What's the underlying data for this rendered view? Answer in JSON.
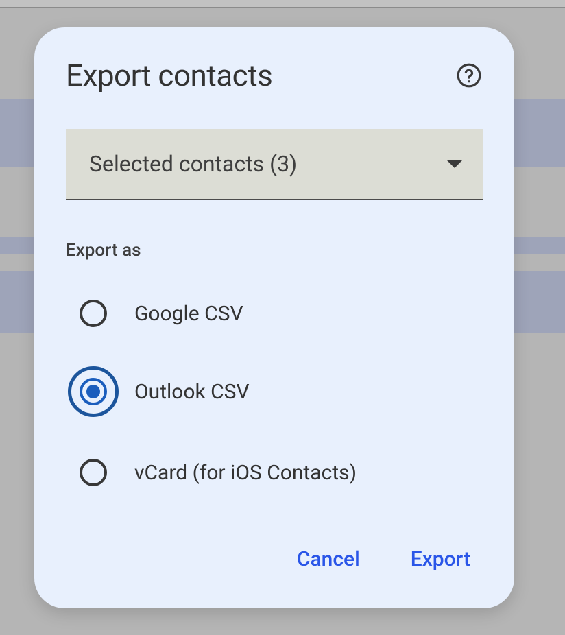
{
  "dialog": {
    "title": "Export contacts",
    "dropdown": {
      "label": "Selected contacts (3)"
    },
    "sectionLabel": "Export as",
    "options": [
      {
        "label": "Google CSV"
      },
      {
        "label": "Outlook CSV"
      },
      {
        "label": "vCard (for iOS Contacts)"
      }
    ],
    "selectedIndex": 1,
    "actions": {
      "cancel": "Cancel",
      "confirm": "Export"
    }
  }
}
